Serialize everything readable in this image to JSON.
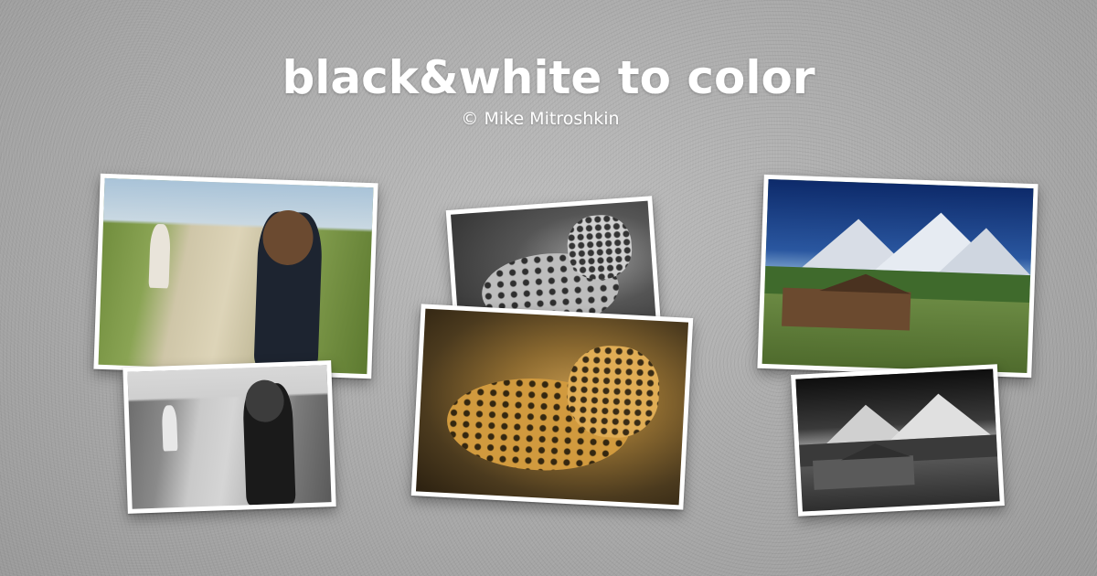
{
  "header": {
    "title": "black&white to color",
    "credit": "© Mike Mitroshkin"
  },
  "photos": [
    {
      "subject": "girl-with-bicycle",
      "variant": "color"
    },
    {
      "subject": "girl-with-bicycle",
      "variant": "black-and-white"
    },
    {
      "subject": "leopard",
      "variant": "black-and-white"
    },
    {
      "subject": "leopard",
      "variant": "color"
    },
    {
      "subject": "barn-and-mountains",
      "variant": "color"
    },
    {
      "subject": "barn-and-mountains",
      "variant": "black-and-white"
    }
  ],
  "colors": {
    "background": "#a9a9a9",
    "text": "#ffffff",
    "photo_border": "#ffffff"
  }
}
